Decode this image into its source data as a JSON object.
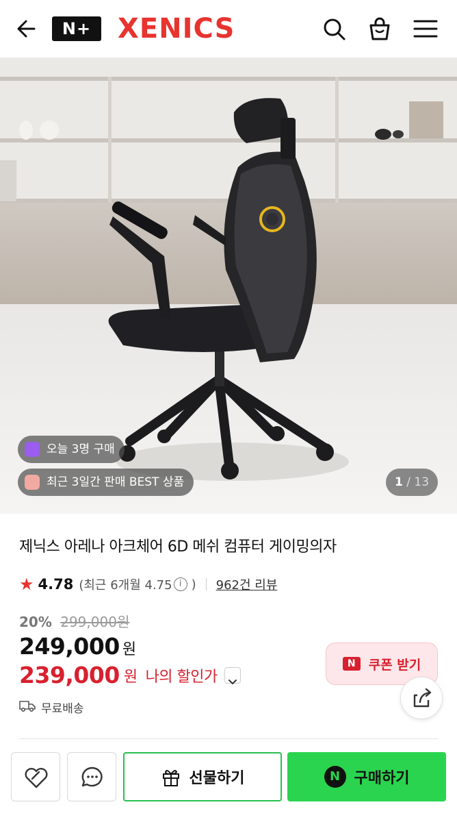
{
  "header": {
    "logo_badge": "N+",
    "brand": "XENICS",
    "icons": [
      "back-arrow-icon",
      "search-icon",
      "shopping-bag-icon",
      "menu-icon"
    ],
    "brand_color": "#e8332f"
  },
  "hero": {
    "badges": [
      {
        "label": "오늘 3명 구매",
        "icon": "purchase-icon"
      },
      {
        "label": "최근 3일간 판매 BEST 상품",
        "icon": "gift-icon"
      }
    ],
    "counter_current": "1",
    "counter_separator": " / ",
    "counter_total": "13"
  },
  "product": {
    "title": "제닉스 아레나 아크체어 6D 메쉬 컴퓨터 게이밍의자",
    "rating": "4.78",
    "rating_recent": "(최근 6개월 4.75",
    "rating_recent_close": ")",
    "reviews": "962건 리뷰",
    "discount_percent": "20%",
    "original_price": "299,000원",
    "price": "249,000",
    "price_unit": "원",
    "my_price": "239,000",
    "my_price_unit": "원",
    "my_price_label": "나의 할인가",
    "shipping": "무료배송",
    "accent_red": "#d8202e"
  },
  "actions": {
    "coupon_badge": "N",
    "coupon": "쿠폰 받기",
    "gift": "선물하기",
    "buy_badge": "N",
    "buy": "구매하기",
    "buy_color": "#2ad44e"
  }
}
